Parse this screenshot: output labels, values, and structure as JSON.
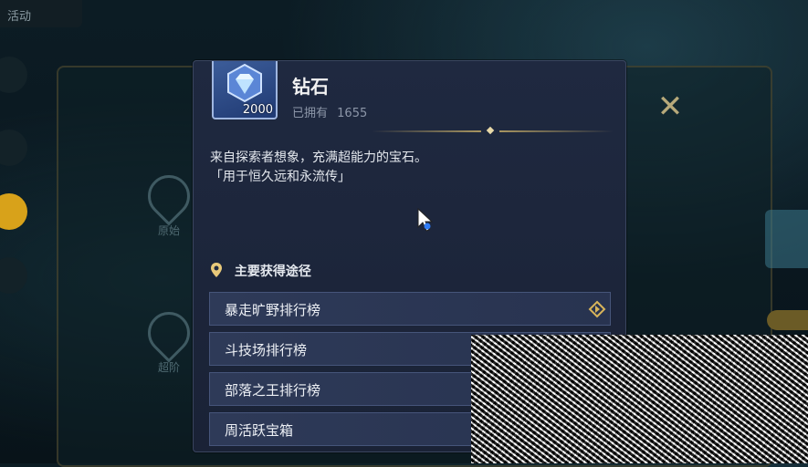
{
  "background": {
    "top_tab": "活动",
    "locations": [
      "原始",
      "超阶"
    ]
  },
  "item": {
    "name": "钻石",
    "quantity": "2000",
    "owned_label": "已拥有",
    "owned_count": "1655",
    "description_line1": "来自探索者想象，充满超能力的宝石。",
    "description_line2": "「用于恒久远和永流传」",
    "icon": "diamond-icon"
  },
  "sources": {
    "title": "主要获得途径",
    "items": [
      {
        "label": "暴走旷野排行榜"
      },
      {
        "label": "斗技场排行榜"
      },
      {
        "label": "部落之王排行榜"
      },
      {
        "label": "周活跃宝箱"
      }
    ]
  },
  "colors": {
    "panel_bg": "#1f2940",
    "row_bg": "#2e3a58",
    "accent_gold": "#d8a21a"
  }
}
